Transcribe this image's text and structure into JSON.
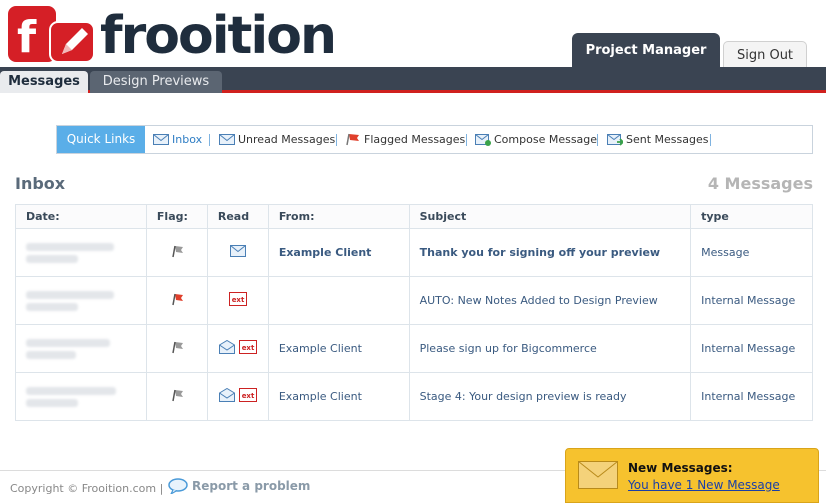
{
  "brand": {
    "name": "frooition"
  },
  "top_tabs": {
    "project_manager": "Project Manager",
    "sign_out": "Sign Out"
  },
  "nav": {
    "messages": "Messages",
    "design_previews": "Design Previews"
  },
  "quick_links": {
    "label": "Quick Links",
    "items": [
      {
        "label": "Inbox",
        "icon": "envelope-icon"
      },
      {
        "label": "Unread Messages",
        "icon": "envelope-icon"
      },
      {
        "label": "Flagged Messages",
        "icon": "flag-icon"
      },
      {
        "label": "Compose Message",
        "icon": "compose-icon"
      },
      {
        "label": "Sent Messages",
        "icon": "sent-icon"
      }
    ]
  },
  "inbox": {
    "title": "Inbox",
    "count": "4 Messages"
  },
  "table": {
    "headers": [
      "Date:",
      "Flag:",
      "Read",
      "From:",
      "Subject",
      "type"
    ],
    "rows": [
      {
        "flag": "grey",
        "read": "envelope",
        "from": "Example Client",
        "subject": "Thank you for signing off your preview",
        "type": "Message",
        "bold": true
      },
      {
        "flag": "red",
        "read": "ext",
        "from": "",
        "subject": "AUTO: New Notes Added to Design Preview",
        "type": "Internal Message",
        "bold": false
      },
      {
        "flag": "grey",
        "read": "open-ext",
        "from": "Example Client",
        "subject": "Please sign up for Bigcommerce",
        "type": "Internal Message",
        "bold": false
      },
      {
        "flag": "grey",
        "read": "open-ext",
        "from": "Example Client",
        "subject": "Stage 4: Your design preview is ready",
        "type": "Internal Message",
        "bold": false
      }
    ]
  },
  "footer": {
    "copyright": "Copyright © Frooition.com |",
    "report": "Report a problem"
  },
  "popup": {
    "title": "New Messages:",
    "link": "You have 1 New Message"
  },
  "colors": {
    "accent_red": "#d0201e",
    "navbar": "#3a4452",
    "quick_blue": "#5aaee8",
    "popup_yellow": "#f6c22e"
  }
}
